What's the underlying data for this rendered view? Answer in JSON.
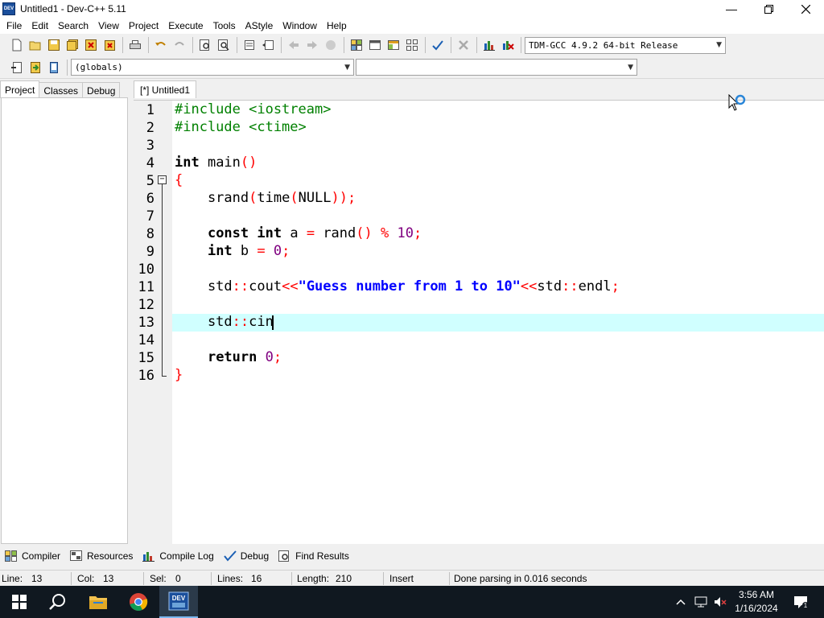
{
  "window": {
    "title": "Untitled1 - Dev-C++ 5.11",
    "icon_text": "DEV"
  },
  "menu": [
    "File",
    "Edit",
    "Search",
    "View",
    "Project",
    "Execute",
    "Tools",
    "AStyle",
    "Window",
    "Help"
  ],
  "toolbar": {
    "compiler_select": "TDM-GCC 4.9.2 64-bit Release",
    "scope_select": "(globals)",
    "member_select": ""
  },
  "left_panel": {
    "tabs": [
      "Project",
      "Classes",
      "Debug"
    ],
    "active_tab": "Project"
  },
  "editor": {
    "tab_label": "[*] Untitled1",
    "line_numbers": [
      "1",
      "2",
      "3",
      "4",
      "5",
      "6",
      "7",
      "8",
      "9",
      "10",
      "11",
      "12",
      "13",
      "14",
      "15",
      "16"
    ],
    "highlight_line": 13
  },
  "bottom_tabs": [
    "Compiler",
    "Resources",
    "Compile Log",
    "Debug",
    "Find Results"
  ],
  "status": {
    "line_label": "Line:",
    "line_value": "13",
    "col_label": "Col:",
    "col_value": "13",
    "sel_label": "Sel:",
    "sel_value": "0",
    "lines_label": "Lines:",
    "lines_value": "16",
    "length_label": "Length:",
    "length_value": "210",
    "mode": "Insert",
    "message": "Done parsing in 0.016 seconds"
  },
  "taskbar": {
    "time": "3:56 AM",
    "date": "1/16/2024"
  },
  "colors": {
    "keyword": "#000000",
    "preprocessor": "#008000",
    "symbol": "#ff0000",
    "number": "#800080",
    "string": "#0000ff",
    "current_line": "#d0ffff"
  },
  "icons": [
    "dev-cpp-icon",
    "new-file-icon",
    "open-icon",
    "save-icon",
    "save-all-icon",
    "close-icon",
    "close-all-icon",
    "print-icon",
    "undo-icon",
    "redo-icon",
    "find-icon",
    "replace-icon",
    "compile-icon",
    "run-icon",
    "compile-run-icon",
    "rebuild-icon",
    "check-icon",
    "stop-icon",
    "chart-icon",
    "profile-icon",
    "windows-start-icon",
    "search-icon",
    "file-explorer-icon",
    "chrome-icon",
    "notification-icon",
    "wait-cursor-icon"
  ]
}
